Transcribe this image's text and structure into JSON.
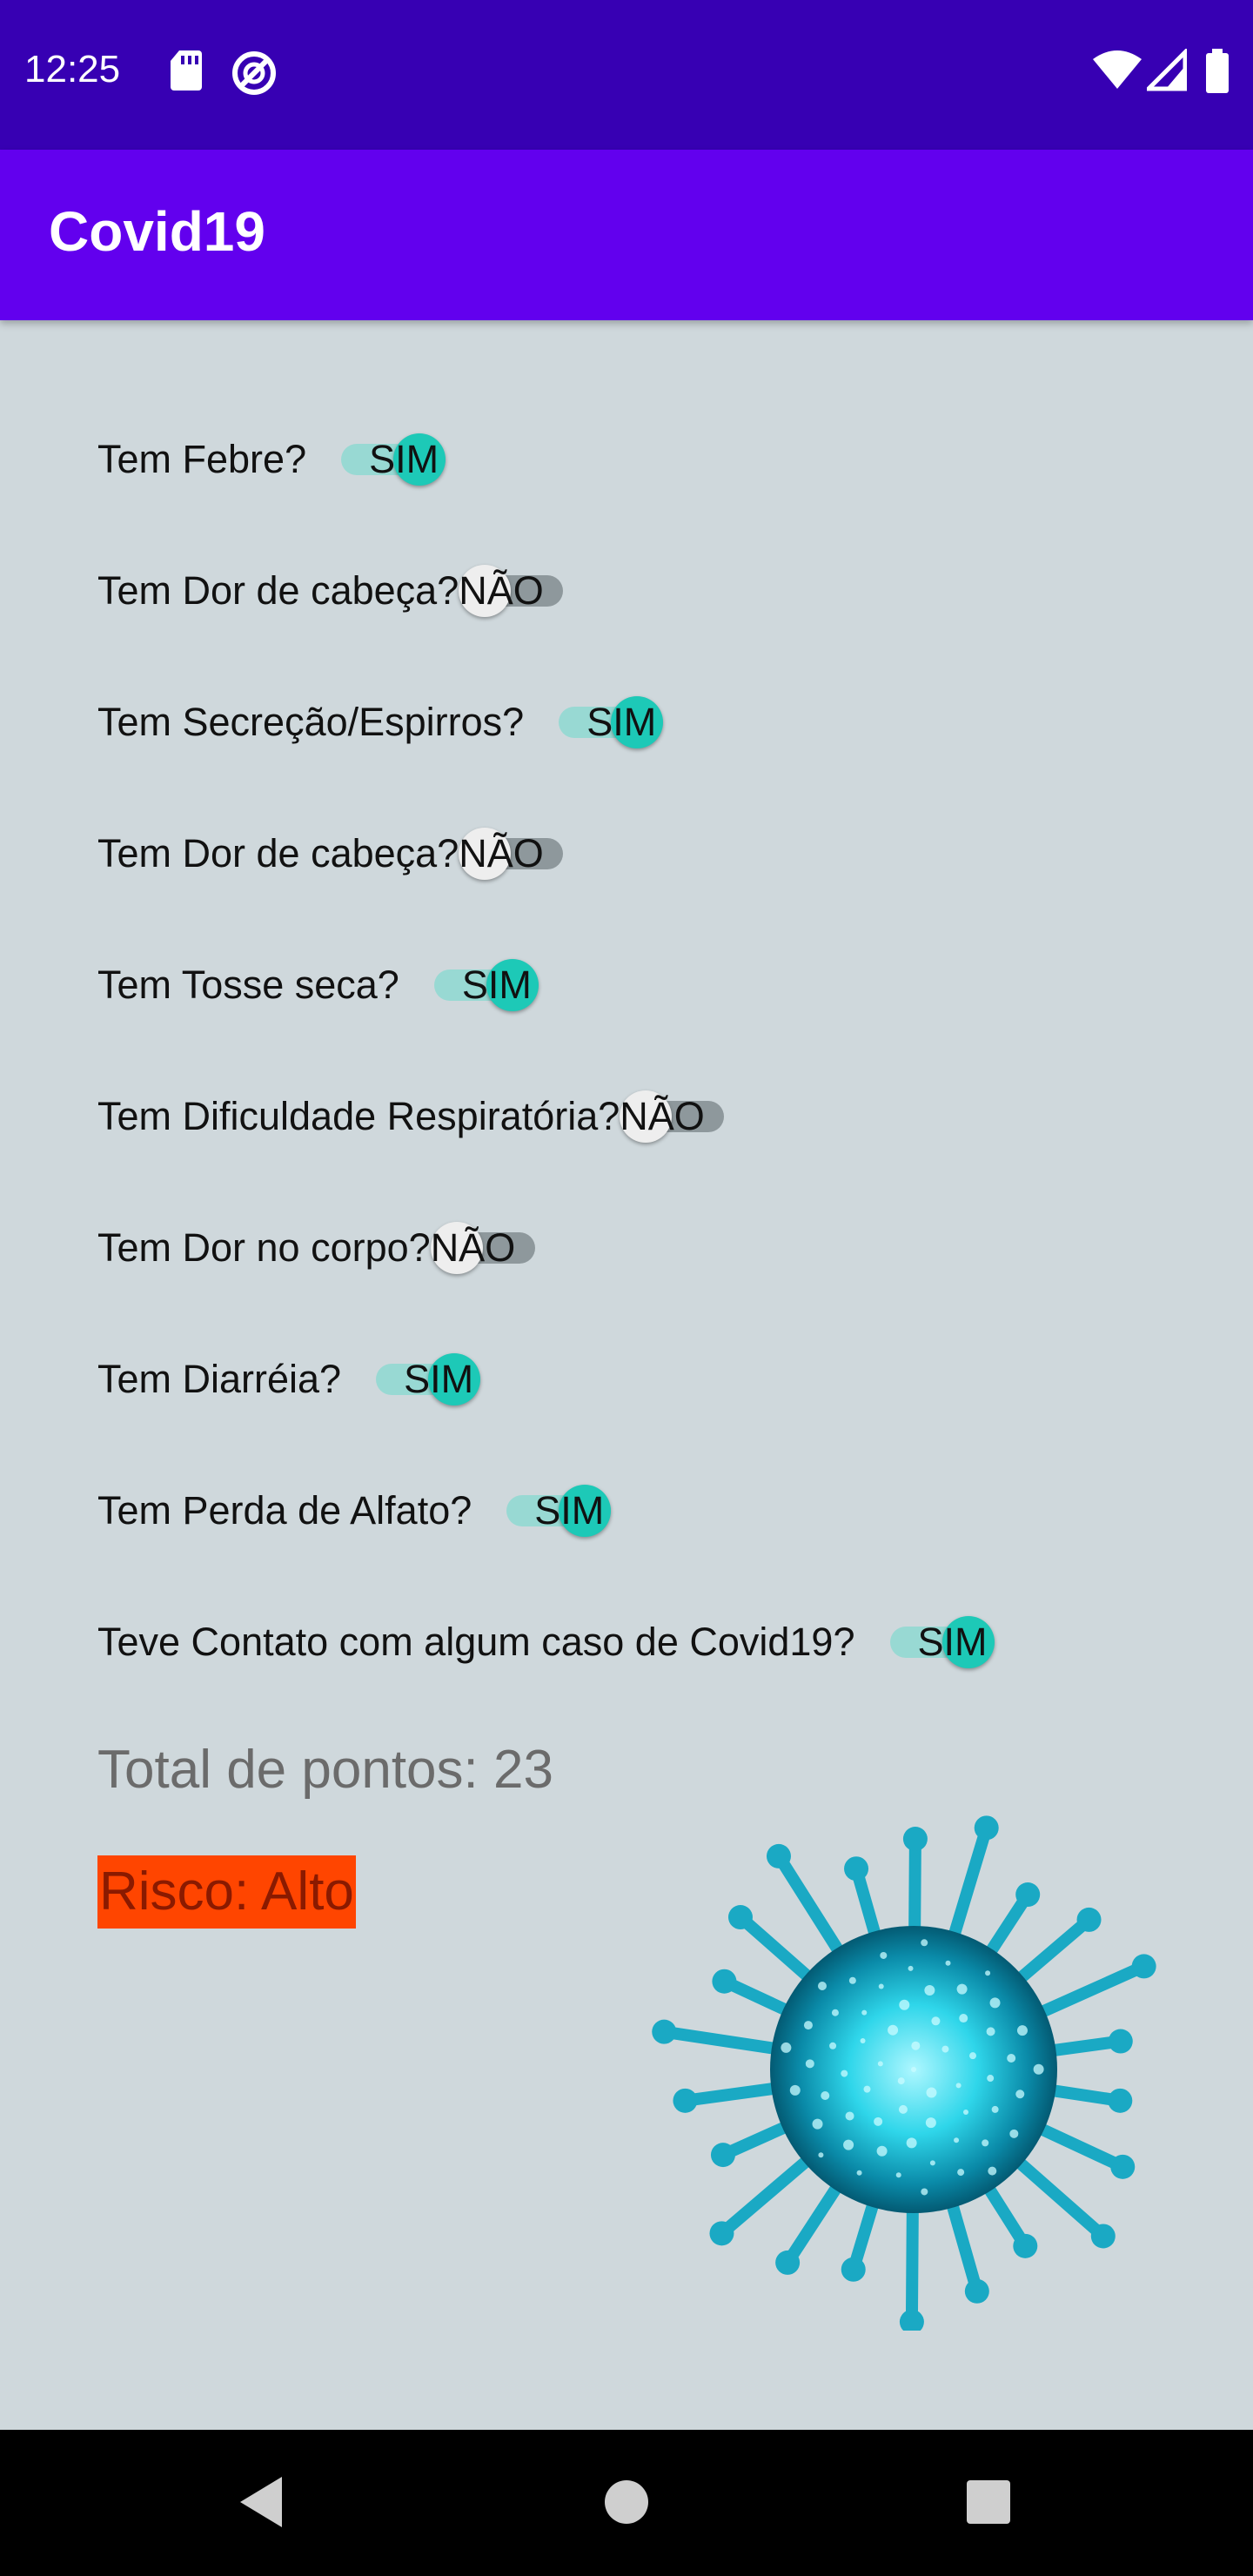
{
  "status_bar": {
    "time": "12:25",
    "icons": [
      "sd-card-icon",
      "do-not-disturb-icon",
      "wifi-icon",
      "signal-icon",
      "battery-icon"
    ]
  },
  "app_bar": {
    "title": "Covid19"
  },
  "questions": [
    {
      "label": "Tem Febre?",
      "state": "SIM",
      "on": true
    },
    {
      "label": "Tem Dor de cabeça?",
      "state": "NÃO",
      "on": false
    },
    {
      "label": "Tem Secreção/Espirros?",
      "state": "SIM",
      "on": true
    },
    {
      "label": "Tem Dor de cabeça?",
      "state": "NÃO",
      "on": false
    },
    {
      "label": "Tem Tosse seca?",
      "state": "SIM",
      "on": true
    },
    {
      "label": "Tem Dificuldade Respiratória?",
      "state": "NÃO",
      "on": false
    },
    {
      "label": "Tem Dor no corpo?",
      "state": "NÃO",
      "on": false
    },
    {
      "label": "Tem Diarréia?",
      "state": "SIM",
      "on": true
    },
    {
      "label": "Tem Perda de Alfato?",
      "state": "SIM",
      "on": true
    },
    {
      "label": "Teve Contato com algum caso de Covid19?",
      "state": "SIM",
      "on": true
    }
  ],
  "result": {
    "total": "Total de pontos: 23",
    "risk": "Risco: Alto"
  },
  "colors": {
    "status_bar": "#3700b3",
    "app_bar": "#6200ee",
    "background": "#cfd8dc",
    "switch_on_thumb": "#1dc9b7",
    "switch_on_track": "#98d9d3",
    "switch_off_track": "#8e989c",
    "risk_badge": "#ff4500"
  },
  "image": {
    "name": "virus-image"
  },
  "nav_bar": {
    "buttons": [
      "back-icon",
      "home-icon",
      "recents-icon"
    ]
  }
}
